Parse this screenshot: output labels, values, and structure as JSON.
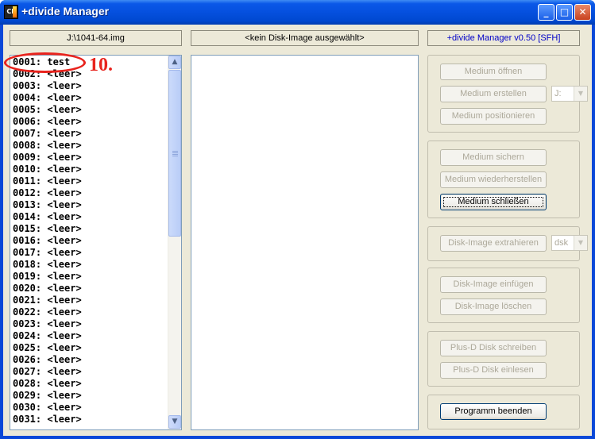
{
  "window": {
    "title": "+divide Manager",
    "minimize_glyph": "_",
    "maximize_glyph": "□",
    "close_glyph": "✕",
    "app_icon": "app-icon",
    "app_icon_text": "CF"
  },
  "header": {
    "image_path": "J:\\1041-64.img",
    "disk_image_status": "<kein Disk-Image ausgewählt>",
    "version": "+divide Manager v0.50 [SFH]"
  },
  "slot_list": {
    "items": [
      "0001: test",
      "0002: <leer>",
      "0003: <leer>",
      "0004: <leer>",
      "0005: <leer>",
      "0006: <leer>",
      "0007: <leer>",
      "0008: <leer>",
      "0009: <leer>",
      "0010: <leer>",
      "0011: <leer>",
      "0012: <leer>",
      "0013: <leer>",
      "0014: <leer>",
      "0015: <leer>",
      "0016: <leer>",
      "0017: <leer>",
      "0018: <leer>",
      "0019: <leer>",
      "0020: <leer>",
      "0021: <leer>",
      "0022: <leer>",
      "0023: <leer>",
      "0024: <leer>",
      "0025: <leer>",
      "0026: <leer>",
      "0027: <leer>",
      "0028: <leer>",
      "0029: <leer>",
      "0030: <leer>",
      "0031: <leer>"
    ],
    "scroll_up_glyph": "▲",
    "scroll_down_glyph": "▼"
  },
  "annotation": {
    "label": "10.",
    "color": "#e8231d"
  },
  "buttons": {
    "medium_oeffnen": "Medium öffnen",
    "medium_erstellen": "Medium erstellen",
    "medium_positionieren": "Medium positionieren",
    "medium_sichern": "Medium sichern",
    "medium_wiederherstellen": "Medium wiederherstellen",
    "medium_schliessen": "Medium schließen",
    "disk_image_extrahieren": "Disk-Image extrahieren",
    "disk_image_einfuegen": "Disk-Image einfügen",
    "disk_image_loeschen": "Disk-Image löschen",
    "plusd_schreiben": "Plus-D Disk schreiben",
    "plusd_einlesen": "Plus-D Disk einlesen",
    "programm_beenden": "Programm beenden"
  },
  "combos": {
    "drive": {
      "value": "J:",
      "arrow": "▼"
    },
    "extension": {
      "value": "dsk",
      "arrow": "▼"
    }
  },
  "colors": {
    "titlebar": "#0550de",
    "client_bg": "#ece9d8",
    "version_text": "#0000c8",
    "disabled_text": "#aca899"
  }
}
